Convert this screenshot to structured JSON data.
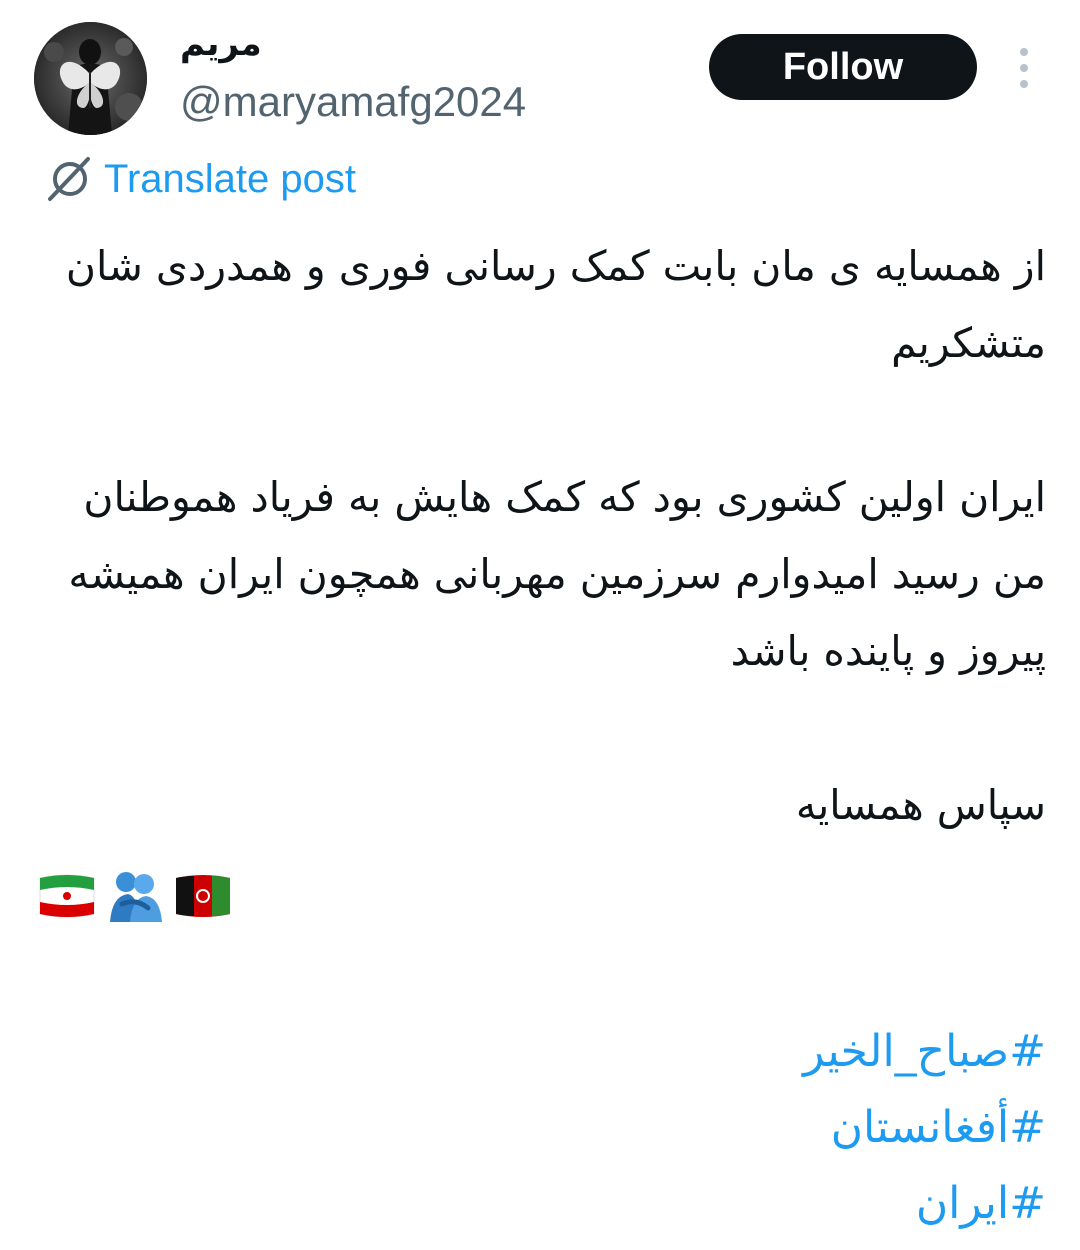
{
  "author": {
    "display_name": "مریم",
    "handle": "@maryamafg2024"
  },
  "actions": {
    "follow_label": "Follow"
  },
  "translate": {
    "label": "Translate post"
  },
  "post": {
    "paragraphs": [
      "از همسایه ی مان بابت کمک رسانی فوری و همدردی شان متشکریم",
      "ایران اولین کشوری بود که کمک هایش به فریاد هموطنان من رسید امیدوارم سرزمین مهربانی همچون ایران همیشه پیروز و پاینده باشد",
      "سپاس همسایه"
    ],
    "emojis": [
      "flag-iran-icon",
      "people-hugging-icon",
      "flag-afghanistan-icon"
    ],
    "hashtags": [
      "#صباح_الخیر",
      "#أفغانستان",
      "#ایران"
    ]
  },
  "colors": {
    "text": "#0f1419",
    "secondary_text": "#536471",
    "link": "#1d9bf0",
    "follow_bg": "#0f1419",
    "follow_text": "#ffffff"
  }
}
